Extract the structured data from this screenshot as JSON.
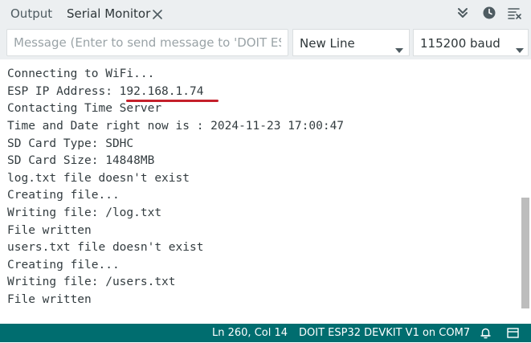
{
  "tabs": {
    "output_label": "Output",
    "serial_label": "Serial Monitor"
  },
  "icons": {
    "close": "close-icon",
    "autoscroll": "double-chevron-down-icon",
    "timestamp": "clock-icon",
    "clear": "clear-output-icon",
    "dropdown": "caret-down-icon",
    "notifications": "bell-icon",
    "panel": "toggle-panel-icon"
  },
  "message": {
    "placeholder": "Message (Enter to send message to 'DOIT ES…",
    "value": ""
  },
  "line_ending": {
    "selected": "New Line"
  },
  "baud": {
    "selected": "115200 baud"
  },
  "output_lines": [
    "Connecting to WiFi...",
    "ESP IP Address: 192.168.1.74",
    "Contacting Time Server",
    "Time and Date right now is : 2024-11-23 17:00:47",
    "SD Card Type: SDHC",
    "SD Card Size: 14848MB",
    "log.txt file doesn't exist",
    "Creating file...",
    "Writing file: /log.txt",
    "File written",
    "users.txt file doesn't exist",
    "Creating file...",
    "Writing file: /users.txt",
    "File written"
  ],
  "status": {
    "position": "Ln 260, Col 14",
    "board": "DOIT ESP32 DEVKIT V1 on COM7"
  },
  "colors": {
    "statusbar": "#006d6f",
    "highlight": "#c5202b",
    "toolbar": "#eceff1"
  }
}
